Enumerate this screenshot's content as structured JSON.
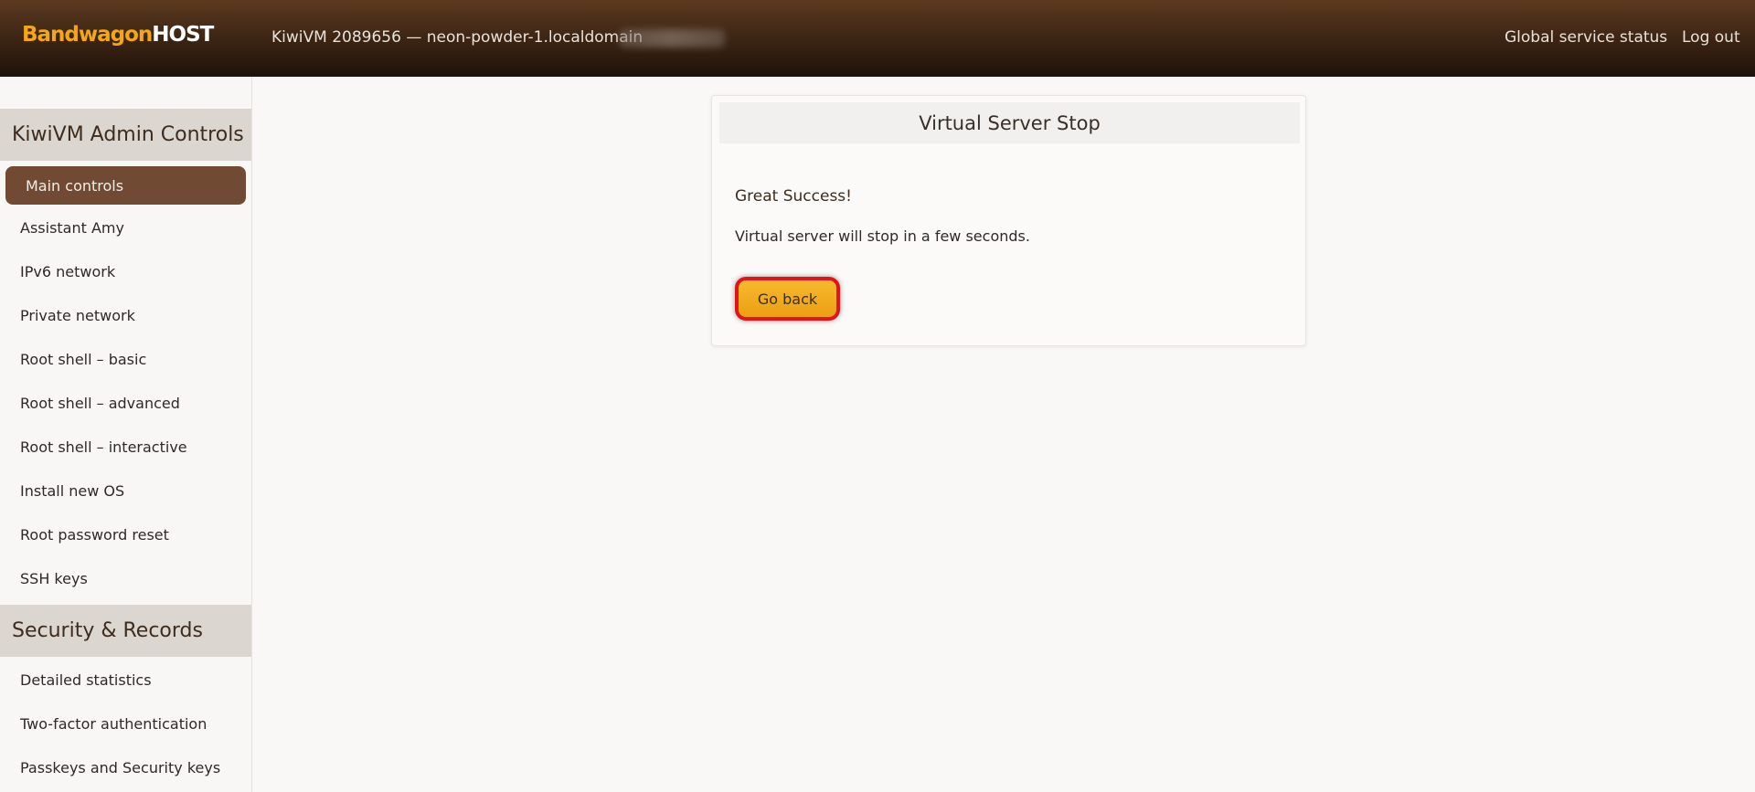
{
  "header": {
    "logo_part1": "Bandwagon",
    "logo_part2": "HOST",
    "vm_title": "KiwiVM 2089656 — neon-powder-1.localdomain",
    "links": {
      "global_status": "Global service status",
      "logout": "Log out"
    }
  },
  "sidebar": {
    "admin_section_title": "KiwiVM Admin Controls",
    "admin_items": [
      "Main controls",
      "Assistant Amy",
      "IPv6 network",
      "Private network",
      "Root shell – basic",
      "Root shell – advanced",
      "Root shell – interactive",
      "Install new OS",
      "Root password reset",
      "SSH keys"
    ],
    "active_item": "Main controls",
    "security_section_title": "Security & Records",
    "security_items": [
      "Detailed statistics",
      "Two-factor authentication",
      "Passkeys and Security keys"
    ]
  },
  "card": {
    "title": "Virtual Server Stop",
    "success_title": "Great Success!",
    "message": "Virtual server will stop in a few seconds.",
    "go_back_label": "Go back"
  },
  "colors": {
    "accent_orange": "#f3a712",
    "active_nav": "#714a33",
    "section_bg": "#dcd6d1",
    "highlight_red": "#e0141c"
  }
}
